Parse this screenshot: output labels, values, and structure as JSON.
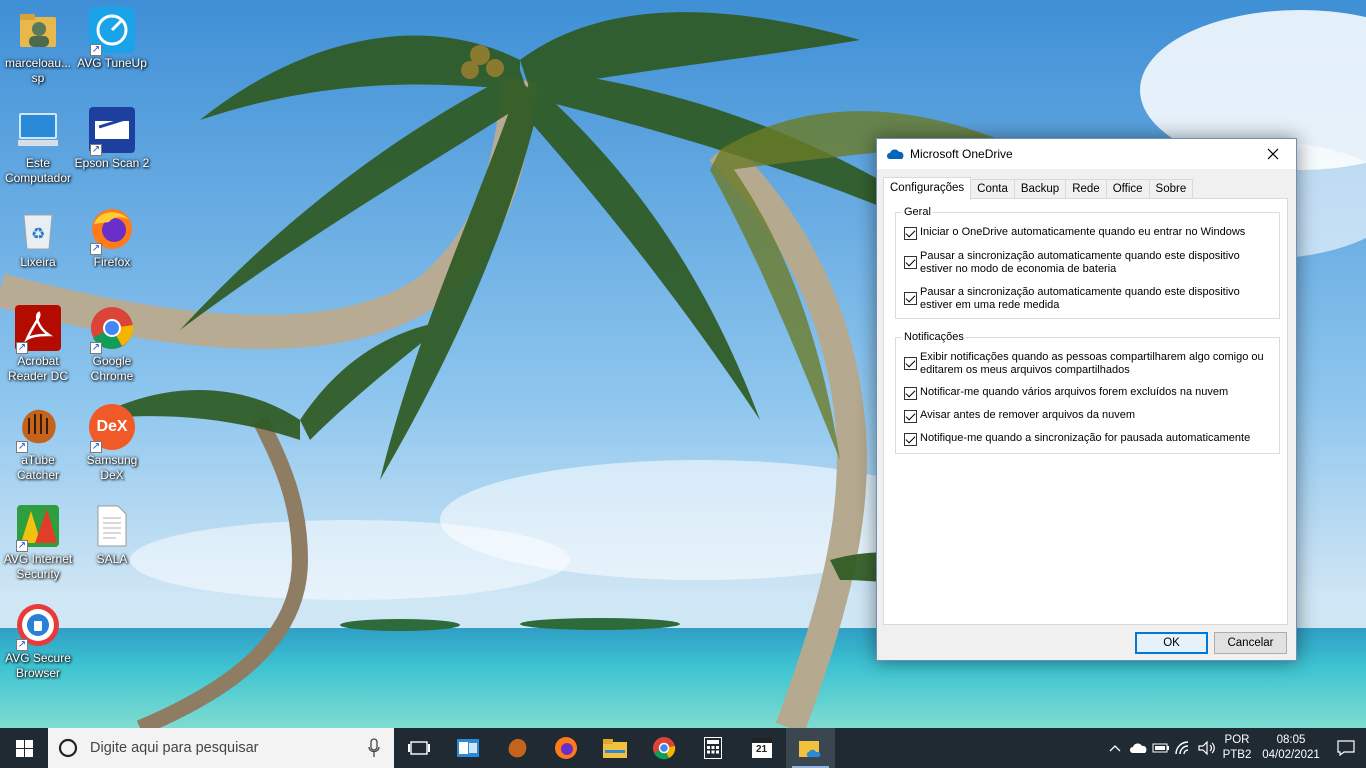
{
  "desktop": {
    "icons": [
      {
        "label": "marceloau... sp",
        "icon": "user-folder-icon"
      },
      {
        "label": "AVG TuneUp",
        "icon": "avg-tuneup-icon"
      },
      {
        "label": "Este Computador",
        "icon": "computer-icon"
      },
      {
        "label": "Epson Scan 2",
        "icon": "scanner-icon"
      },
      {
        "label": "Lixeira",
        "icon": "recycle-bin-icon"
      },
      {
        "label": "Firefox",
        "icon": "firefox-icon"
      },
      {
        "label": "Acrobat Reader DC",
        "icon": "acrobat-icon"
      },
      {
        "label": "Google Chrome",
        "icon": "chrome-icon"
      },
      {
        "label": "aTube Catcher",
        "icon": "atube-icon"
      },
      {
        "label": "Samsung DeX",
        "icon": "dex-icon"
      },
      {
        "label": "AVG Internet Security",
        "icon": "avg-security-icon"
      },
      {
        "label": "SALA",
        "icon": "text-file-icon"
      },
      {
        "label": "AVG Secure Browser",
        "icon": "avg-browser-icon"
      }
    ],
    "dex_badge": "DeX"
  },
  "dialog": {
    "title": "Microsoft OneDrive",
    "tabs": [
      "Configurações",
      "Conta",
      "Backup",
      "Rede",
      "Office",
      "Sobre"
    ],
    "active_tab": "Configurações",
    "groups": [
      {
        "legend": "Geral",
        "options": [
          {
            "text": "Iniciar o OneDrive automaticamente quando eu entrar no Windows",
            "checked": true
          },
          {
            "text": "Pausar a sincronização automaticamente quando este dispositivo estiver no modo de economia de bateria",
            "checked": true
          },
          {
            "text": "Pausar a sincronização automaticamente quando este dispositivo estiver em uma rede medida",
            "checked": true
          }
        ]
      },
      {
        "legend": "Notificações",
        "options": [
          {
            "text": "Exibir notificações quando as pessoas compartilharem algo comigo ou editarem os meus arquivos compartilhados",
            "checked": true
          },
          {
            "text": "Notificar-me quando vários arquivos forem excluídos na nuvem",
            "checked": true
          },
          {
            "text": "Avisar antes de remover arquivos da nuvem",
            "checked": true
          },
          {
            "text": "Notifique-me quando a sincronização for pausada automaticamente",
            "checked": true
          }
        ]
      }
    ],
    "ok_label": "OK",
    "cancel_label": "Cancelar"
  },
  "taskbar": {
    "search_placeholder": "Digite aqui para pesquisar",
    "pinned": [
      "task-view-icon",
      "outlook-icon",
      "atube-icon",
      "firefox-icon",
      "file-explorer-icon",
      "chrome-icon",
      "calculator-icon",
      "calendar-icon",
      "onedrive-settings-icon"
    ],
    "calendar_day": "21",
    "language_line1": "POR",
    "language_line2": "PTB2",
    "time": "08:05",
    "date": "04/02/2021"
  },
  "colors": {
    "taskbar": "#1f2a33",
    "accent": "#0078d7",
    "onedrive_blue": "#0364b8"
  }
}
